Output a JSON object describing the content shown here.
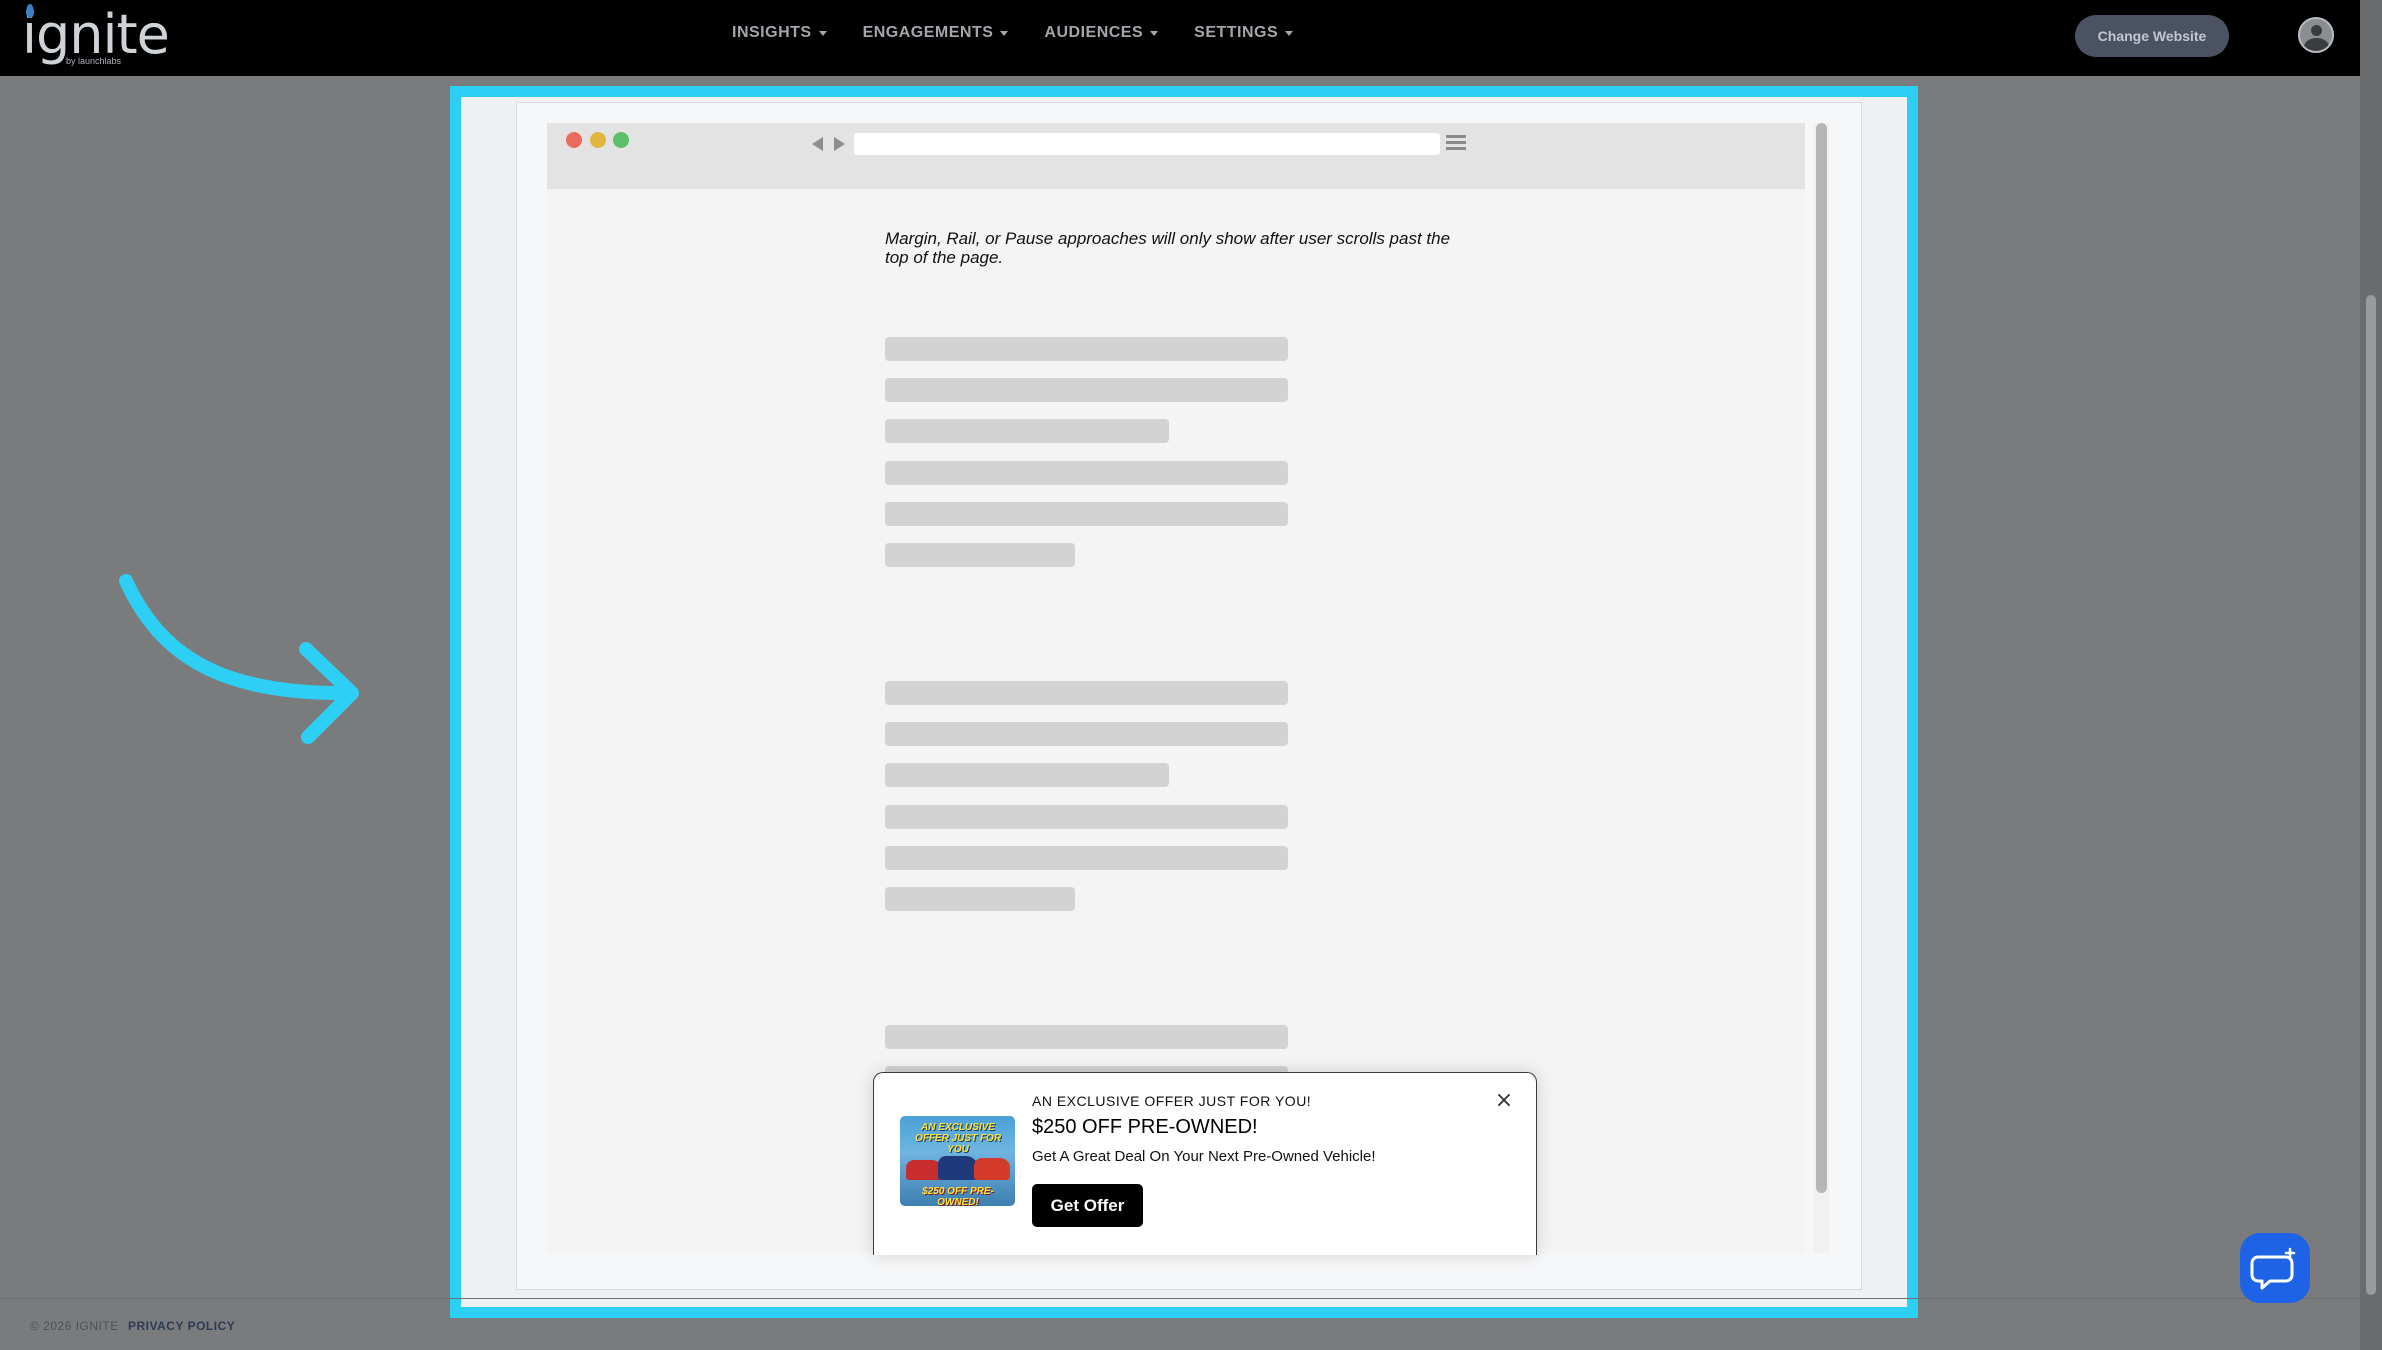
{
  "app": {
    "logo_text": "ignite",
    "logo_sub": "by launchlabs"
  },
  "nav": {
    "items": [
      {
        "label": "INSIGHTS"
      },
      {
        "label": "ENGAGEMENTS"
      },
      {
        "label": "AUDIENCES"
      },
      {
        "label": "SETTINGS"
      }
    ],
    "change_website": "Change Website",
    "avatar_icon": "user-avatar-icon"
  },
  "preview": {
    "note": "Margin, Rail, or Pause approaches will only show after user scrolls past the top of the page.",
    "popup": {
      "eyebrow": "AN EXCLUSIVE OFFER JUST FOR YOU!",
      "title": "$250 OFF PRE-OWNED!",
      "subtitle": "Get A Great Deal On Your Next Pre-Owned Vehicle!",
      "button": "Get Offer",
      "close_icon": "close-icon",
      "image_top_text": "AN EXCLUSIVE OFFER JUST FOR YOU",
      "image_bottom_text": "$250 OFF PRE-OWNED!"
    }
  },
  "footer": {
    "copyright": "© 2026 IGNITE",
    "privacy": "PRIVACY POLICY"
  },
  "colors": {
    "highlight": "#2ecff5",
    "nav_bg": "#000000",
    "chat_button": "#1e63e6",
    "page_overlay": "#7a7b7d"
  }
}
